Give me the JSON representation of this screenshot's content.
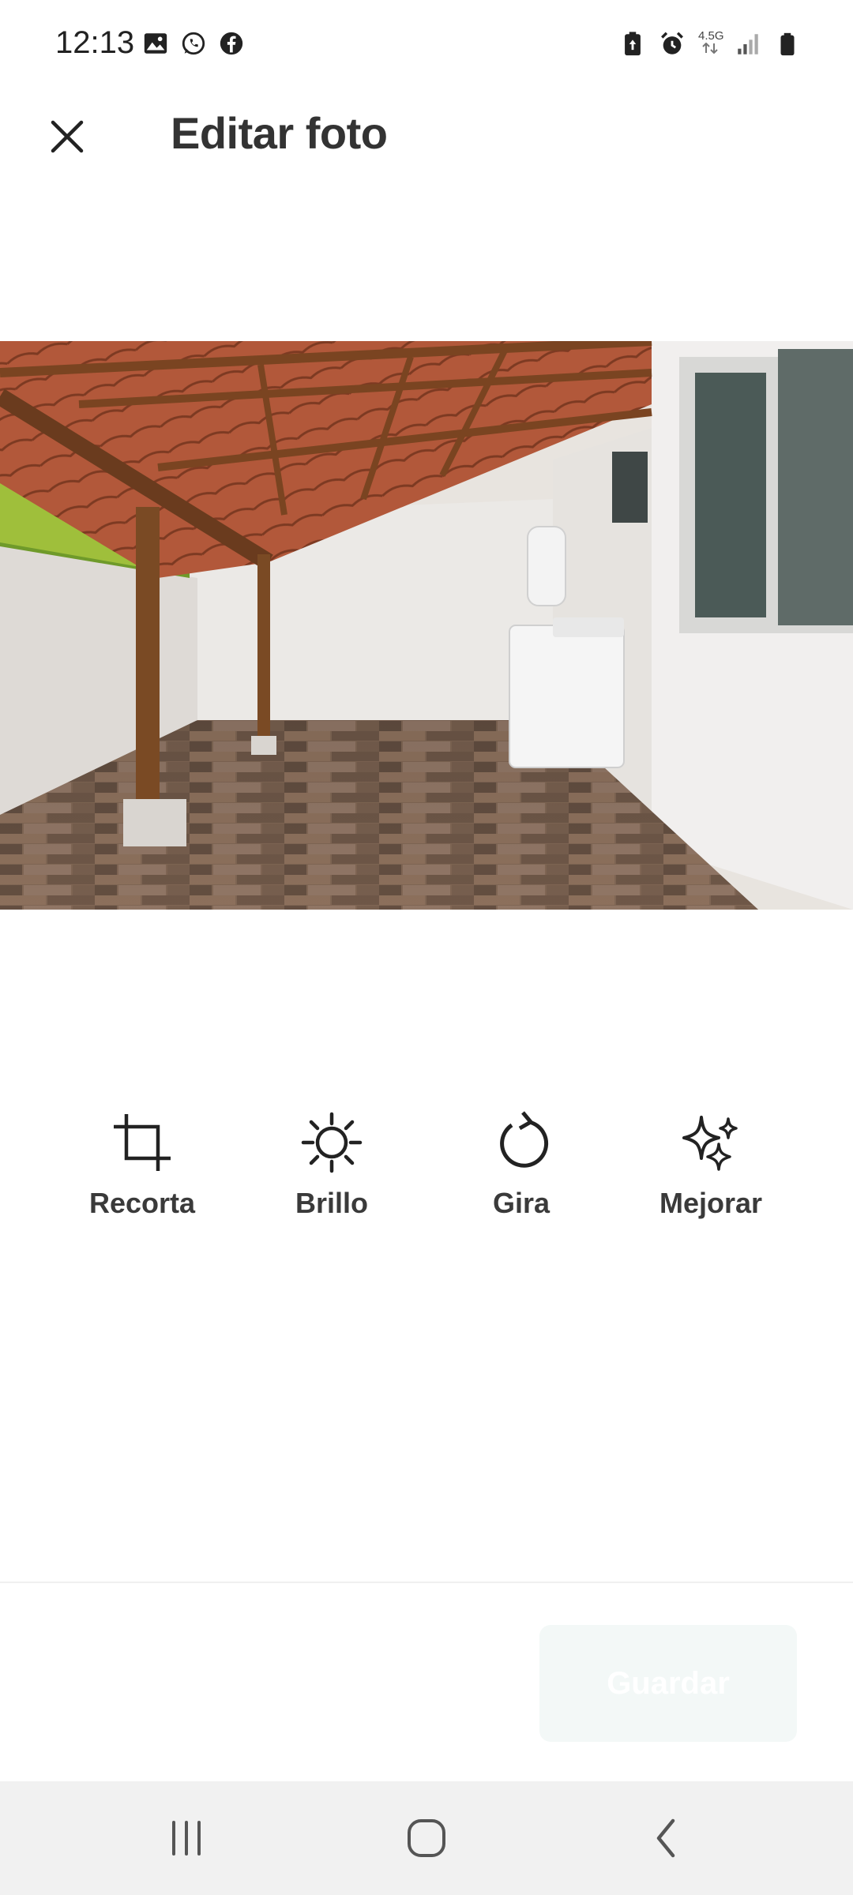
{
  "status_bar": {
    "time": "12:13",
    "left_icons": [
      "gallery-icon",
      "whatsapp-icon",
      "facebook-icon"
    ],
    "right_icons": [
      "battery-saver-icon",
      "alarm-icon",
      "network-4-5g-icon",
      "signal-icon",
      "battery-icon"
    ],
    "network_label": "4.5G"
  },
  "header": {
    "title": "Editar foto",
    "close_icon": "close-icon"
  },
  "photo": {
    "subject": "covered patio with tile roof, wooden posts, washing machine"
  },
  "tools": [
    {
      "label": "Recorta",
      "icon": "crop-icon"
    },
    {
      "label": "Brillo",
      "icon": "brightness-icon"
    },
    {
      "label": "Gira",
      "icon": "rotate-icon"
    },
    {
      "label": "Mejorar",
      "icon": "sparkles-icon"
    }
  ],
  "footer": {
    "save_label": "Guardar"
  },
  "nav": {
    "recents": "recents-icon",
    "home": "home-icon",
    "back": "back-icon"
  },
  "colors": {
    "text": "#333333",
    "save_bg": "#f3f8f7",
    "nav_bg": "#f1f1f1"
  }
}
